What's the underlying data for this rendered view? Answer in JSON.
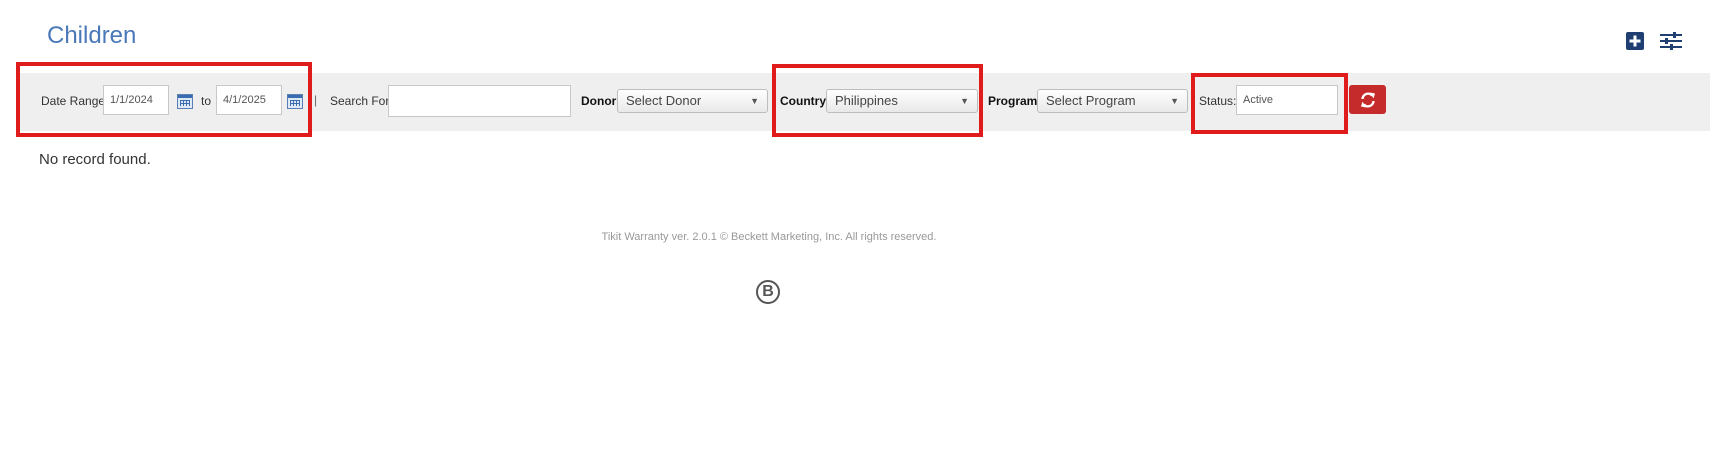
{
  "page": {
    "title": "Children"
  },
  "toolbar": {
    "add_icon": "plus-square-icon",
    "settings_icon": "sliders-icon"
  },
  "filters": {
    "date_range_label": "Date Range:",
    "date_from": "1/1/2024",
    "to_label": "to",
    "date_to": "4/1/2025",
    "separator": "|",
    "search_label": "Search For:",
    "search_value": "",
    "donor_label": "Donor:",
    "donor_value": "Select Donor",
    "country_label": "Country:",
    "country_value": "Philippines",
    "program_label": "Program:",
    "program_value": "Select Program",
    "status_label": "Status:",
    "status_value": "Active",
    "refresh_icon": "refresh-icon"
  },
  "results": {
    "message": "No record found."
  },
  "footer": {
    "text": "Tikit Warranty ver. 2.0.1 © Beckett Marketing, Inc. All rights reserved.",
    "logo_text": "B"
  },
  "colors": {
    "title": "#4a78b8",
    "accent_blue": "#1f3f73",
    "refresh": "#c62b2b",
    "highlight": "#e01b1b",
    "filter_bar": "#efefef"
  }
}
